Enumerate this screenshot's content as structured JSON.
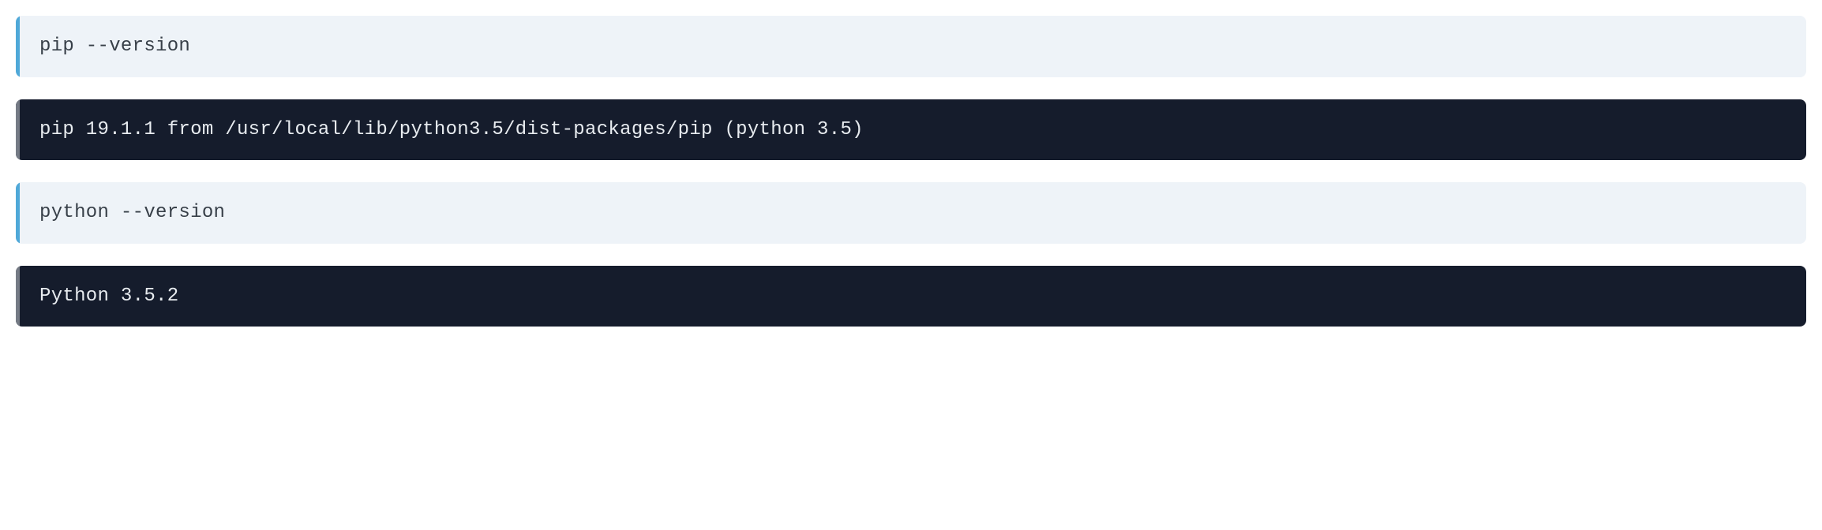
{
  "blocks": [
    {
      "type": "input",
      "content": "pip --version"
    },
    {
      "type": "output",
      "content": "pip 19.1.1 from /usr/local/lib/python3.5/dist-packages/pip (python 3.5)"
    },
    {
      "type": "input",
      "content": "python --version"
    },
    {
      "type": "output",
      "content": "Python 3.5.2"
    }
  ]
}
